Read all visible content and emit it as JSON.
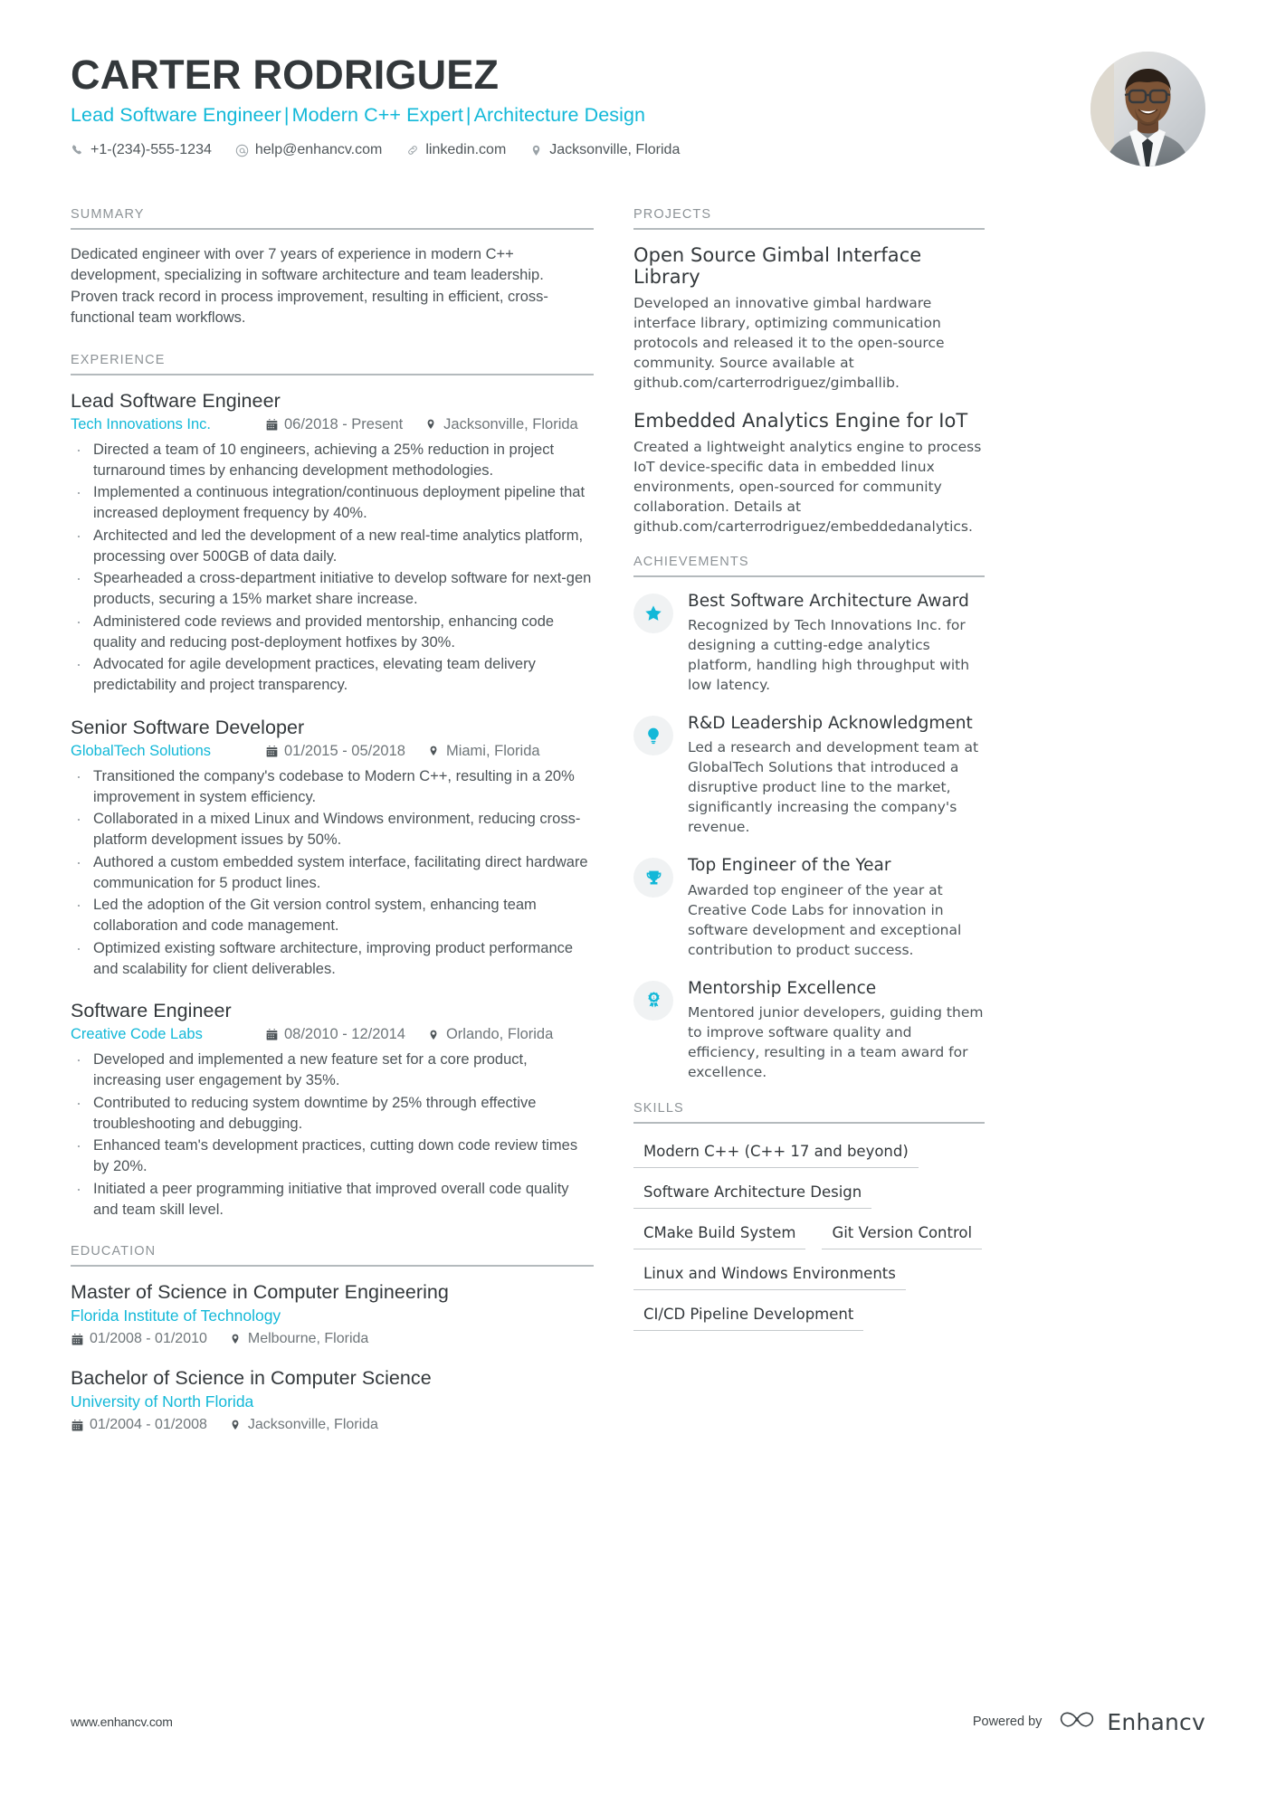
{
  "theme": {
    "accent": "#12b8d8",
    "heading": "#33383b",
    "body_text": "#4d5458",
    "muted": "#8d9397",
    "rule": "#b4babd",
    "badge_bg": "#f0f2f3"
  },
  "header": {
    "full_name": "CARTER RODRIGUEZ",
    "headline_parts": [
      "Lead Software Engineer",
      "Modern C++ Expert",
      "Architecture Design"
    ],
    "headline_separator": "|",
    "contacts": [
      {
        "icon": "phone-icon",
        "text": "+1-(234)-555-1234"
      },
      {
        "icon": "email-icon",
        "text": "help@enhancv.com"
      },
      {
        "icon": "link-icon",
        "text": "linkedin.com"
      },
      {
        "icon": "location-pin-icon",
        "text": "Jacksonville, Florida"
      }
    ],
    "avatar_alt": "Profile photo of a smiling man wearing glasses and a grey suit"
  },
  "left_column": {
    "summary": {
      "heading": "SUMMARY",
      "text": "Dedicated engineer with over 7 years of experience in modern C++ development, specializing in software architecture and team leadership. Proven track record in process improvement, resulting in efficient, cross-functional team workflows."
    },
    "experience": {
      "heading": "EXPERIENCE",
      "entries": [
        {
          "title": "Lead Software Engineer",
          "organization": "Tech Innovations Inc.",
          "dates": "06/2018 - Present",
          "location": "Jacksonville, Florida",
          "bullets": [
            "Directed a team of 10 engineers, achieving a 25% reduction in project turnaround times by enhancing development methodologies.",
            "Implemented a continuous integration/continuous deployment pipeline that increased deployment frequency by 40%.",
            "Architected and led the development of a new real-time analytics platform, processing over 500GB of data daily.",
            "Spearheaded a cross-department initiative to develop software for next-gen products, securing a 15% market share increase.",
            "Administered code reviews and provided mentorship, enhancing code quality and reducing post-deployment hotfixes by 30%.",
            "Advocated for agile development practices, elevating team delivery predictability and project transparency."
          ]
        },
        {
          "title": "Senior Software Developer",
          "organization": "GlobalTech Solutions",
          "dates": "01/2015 - 05/2018",
          "location": "Miami, Florida",
          "bullets": [
            "Transitioned the company's codebase to Modern C++, resulting in a 20% improvement in system efficiency.",
            "Collaborated in a mixed Linux and Windows environment, reducing cross-platform development issues by 50%.",
            "Authored a custom embedded system interface, facilitating direct hardware communication for 5 product lines.",
            "Led the adoption of the Git version control system, enhancing team collaboration and code management.",
            "Optimized existing software architecture, improving product performance and scalability for client deliverables."
          ]
        },
        {
          "title": "Software Engineer",
          "organization": "Creative Code Labs",
          "dates": "08/2010 - 12/2014",
          "location": "Orlando, Florida",
          "bullets": [
            "Developed and implemented a new feature set for a core product, increasing user engagement by 35%.",
            "Contributed to reducing system downtime by 25% through effective troubleshooting and debugging.",
            "Enhanced team's development practices, cutting down code review times by 20%.",
            "Initiated a peer programming initiative that improved overall code quality and team skill level."
          ]
        }
      ]
    },
    "education": {
      "heading": "EDUCATION",
      "entries": [
        {
          "degree": "Master of Science in Computer Engineering",
          "school": "Florida Institute of Technology",
          "dates": "01/2008 - 01/2010",
          "location": "Melbourne, Florida"
        },
        {
          "degree": "Bachelor of Science in Computer Science",
          "school": "University of North Florida",
          "dates": "01/2004 - 01/2008",
          "location": "Jacksonville, Florida"
        }
      ]
    }
  },
  "right_column": {
    "projects": {
      "heading": "PROJECTS",
      "entries": [
        {
          "title": "Open Source Gimbal Interface Library",
          "description": "Developed an innovative gimbal hardware interface library, optimizing communication protocols and released it to the open-source community. Source available at github.com/carterrodriguez/gimballib."
        },
        {
          "title": "Embedded Analytics Engine for IoT",
          "description": "Created a lightweight analytics engine to process IoT device-specific data in embedded linux environments, open-sourced for community collaboration. Details at github.com/carterrodriguez/embeddedanalytics."
        }
      ]
    },
    "achievements": {
      "heading": "ACHIEVEMENTS",
      "entries": [
        {
          "icon": "star-icon",
          "title": "Best Software Architecture Award",
          "description": "Recognized by Tech Innovations Inc. for designing a cutting-edge analytics platform, handling high throughput with low latency."
        },
        {
          "icon": "lightbulb-icon",
          "title": "R&D Leadership Acknowledgment",
          "description": "Led a research and development team at GlobalTech Solutions that introduced a disruptive product line to the market, significantly increasing the company's revenue."
        },
        {
          "icon": "trophy-icon",
          "title": "Top Engineer of the Year",
          "description": "Awarded top engineer of the year at Creative Code Labs for innovation in software development and exceptional contribution to product success."
        },
        {
          "icon": "award-ribbon-icon",
          "title": "Mentorship Excellence",
          "description": "Mentored junior developers, guiding them to improve software quality and efficiency, resulting in a team award for excellence."
        }
      ]
    },
    "skills": {
      "heading": "SKILLS",
      "items": [
        "Modern C++ (C++ 17 and beyond)",
        "Software Architecture Design",
        "CMake Build System",
        "Git Version Control",
        "Linux and Windows Environments",
        "CI/CD Pipeline Development"
      ]
    }
  },
  "footer": {
    "url": "www.enhancv.com",
    "powered_by": "Powered by",
    "brand_name": "Enhancv"
  }
}
